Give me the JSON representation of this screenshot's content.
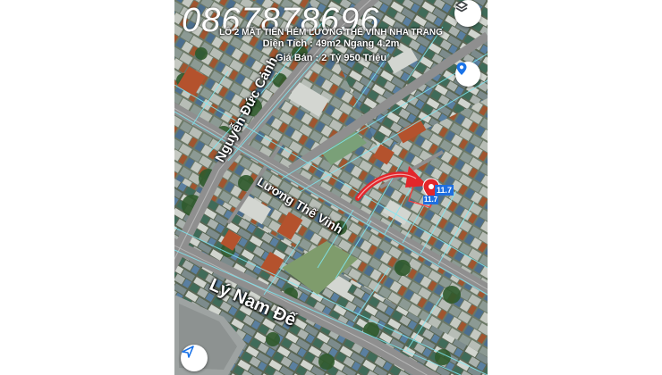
{
  "overlay": {
    "phone": "0867878696",
    "line1": "LÔ 2 MẶT TIỀN HẺM LƯƠNG THẾ VINH NHA TRANG",
    "line2": "Diện Tích : 49m2 Ngang 4.2m",
    "line3": "Giá Bán : 2 Tỷ 950 Triệu"
  },
  "streets": {
    "s1": "Nguyễn Đức Cảnh",
    "s2": "Lương Thế Vinh",
    "s3": "Lý Nam Đế"
  },
  "parcel": {
    "label_main": "11.7",
    "label_small": "11.7"
  },
  "controls": {
    "layers_icon": "layers-icon",
    "location_icon": "location-pin-icon",
    "navigate_icon": "navigation-arrow-icon"
  },
  "colors": {
    "marker": "#e3262b",
    "arrow": "#e3262b",
    "label_bg": "#1f6fe0",
    "boundary": "#7fe8f2"
  }
}
